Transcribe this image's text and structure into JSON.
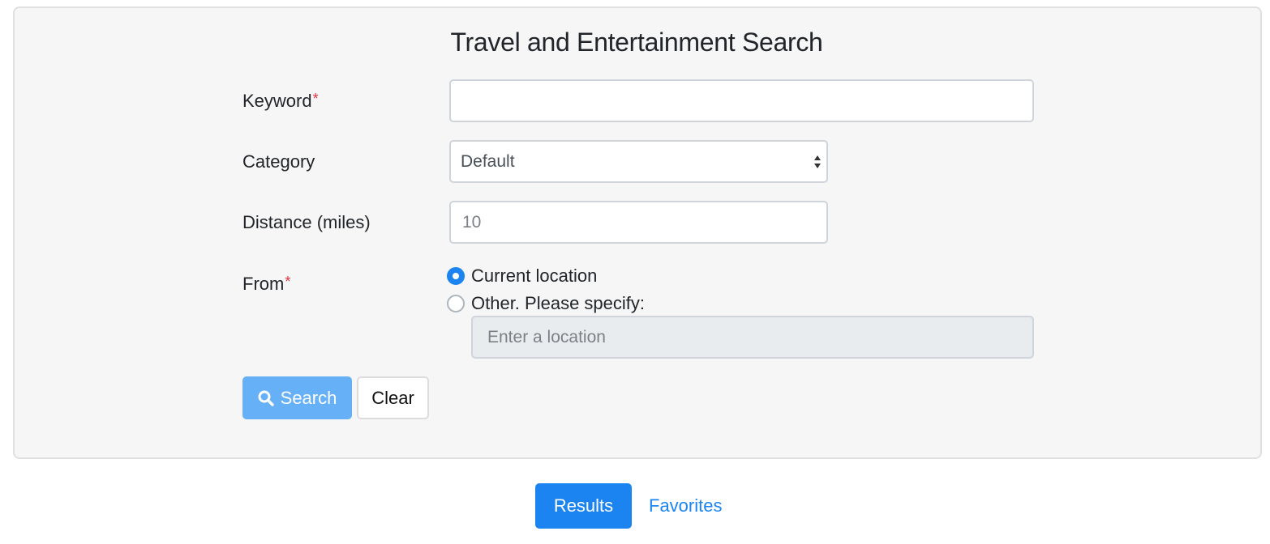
{
  "form": {
    "title": "Travel and Entertainment Search",
    "keyword": {
      "label": "Keyword",
      "required_mark": "*",
      "value": ""
    },
    "category": {
      "label": "Category",
      "selected": "Default"
    },
    "distance": {
      "label": "Distance (miles)",
      "placeholder": "10",
      "value": ""
    },
    "from": {
      "label": "From",
      "required_mark": "*",
      "options": [
        {
          "label": "Current location",
          "checked": true
        },
        {
          "label": "Other. Please specify:",
          "checked": false
        }
      ],
      "location_placeholder": "Enter a location",
      "location_value": ""
    },
    "buttons": {
      "search_label": "Search",
      "clear_label": "Clear"
    }
  },
  "nav": {
    "results_label": "Results",
    "favorites_label": "Favorites"
  },
  "colors": {
    "primary": "#1b84f0",
    "primary_disabled": "#66b0f7",
    "required": "#dc3545",
    "panel_bg": "#f6f6f6",
    "disabled_field_bg": "#e9ecef"
  },
  "icons": {
    "search_button_icon": "search-icon",
    "select_icon": "sort-arrows-icon"
  }
}
